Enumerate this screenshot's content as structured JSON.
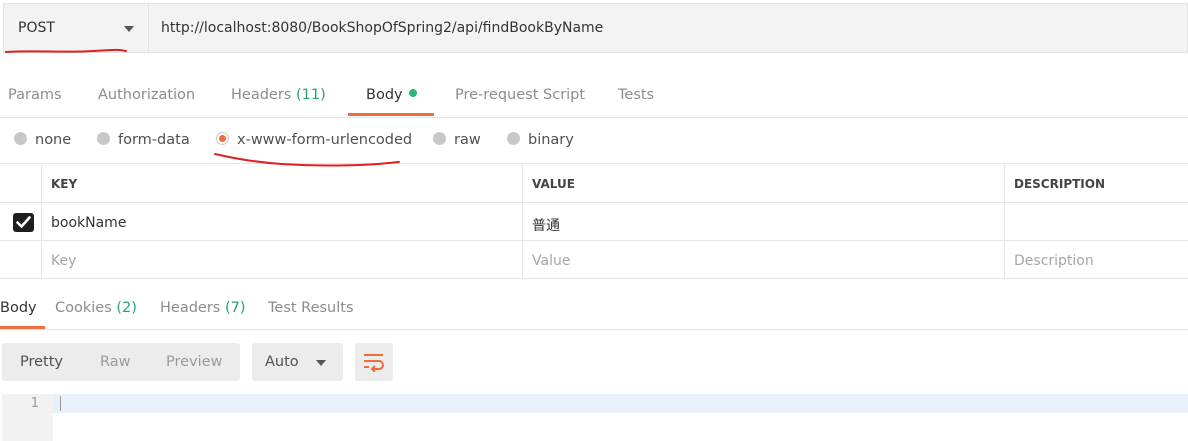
{
  "request": {
    "method": "POST",
    "url": "http://localhost:8080/BookShopOfSpring2/api/findBookByName"
  },
  "request_tabs": [
    {
      "label": "Params"
    },
    {
      "label": "Authorization"
    },
    {
      "label": "Headers ",
      "count": "(11)"
    },
    {
      "label": "Body",
      "active": true
    },
    {
      "label": "Pre-request Script"
    },
    {
      "label": "Tests"
    }
  ],
  "body_types": [
    {
      "label": "none",
      "selected": false
    },
    {
      "label": "form-data",
      "selected": false
    },
    {
      "label": "x-www-form-urlencoded",
      "selected": true
    },
    {
      "label": "raw",
      "selected": false
    },
    {
      "label": "binary",
      "selected": false
    }
  ],
  "kv_table": {
    "headers": {
      "key": "KEY",
      "value": "VALUE",
      "description": "DESCRIPTION"
    },
    "rows": [
      {
        "checked": true,
        "key": "bookName",
        "value": "普通",
        "description": ""
      }
    ],
    "placeholder": {
      "key": "Key",
      "value": "Value",
      "description": "Description"
    }
  },
  "response_tabs": [
    {
      "label": "Body",
      "active": true
    },
    {
      "label": "Cookies ",
      "count": "(2)"
    },
    {
      "label": "Headers ",
      "count": "(7)"
    },
    {
      "label": "Test Results"
    }
  ],
  "response_toolbar": {
    "views": [
      "Pretty",
      "Raw",
      "Preview"
    ],
    "active_view": "Pretty",
    "format": "Auto"
  },
  "editor": {
    "line_numbers": [
      "1"
    ]
  },
  "colors": {
    "accent": "#f26b3a",
    "success": "#2ab673",
    "count": "#2aa36b",
    "annotation": "#e02020"
  }
}
